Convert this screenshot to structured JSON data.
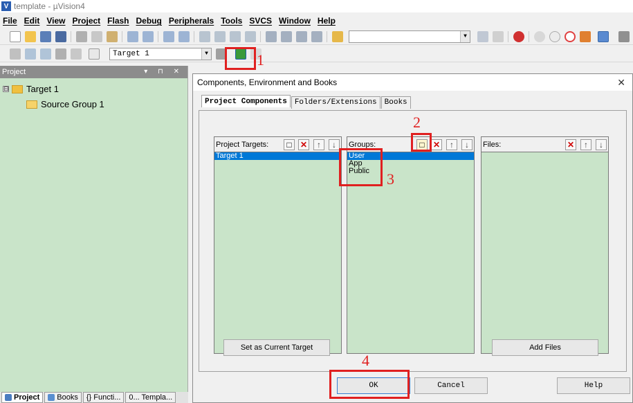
{
  "window": {
    "title": "template  - µVision4",
    "app_icon": "uv-logo-icon"
  },
  "menu": [
    "File",
    "Edit",
    "View",
    "Project",
    "Flash",
    "Debug",
    "Peripherals",
    "Tools",
    "SVCS",
    "Window",
    "Help"
  ],
  "toolbar2": {
    "target_combo": "Target 1"
  },
  "project_panel": {
    "header": "Project",
    "header_buttons": "▾ ⊓ ✕",
    "tree": [
      {
        "label": "Target 1",
        "expander": "⊟"
      },
      {
        "label": "Source Group 1"
      }
    ]
  },
  "bottom_tabs": [
    "Project",
    "Books",
    "{} Functi...",
    "0... Templa..."
  ],
  "dialog": {
    "title": "Components, Environment and Books",
    "close_glyph": "✕",
    "tabs": [
      "Project Components",
      "Folders/Extensions",
      "Books"
    ],
    "columns": {
      "targets": {
        "label": "Project Targets:",
        "items": [
          "Target 1"
        ]
      },
      "groups": {
        "label": "Groups:",
        "items": [
          "User",
          "App",
          "Public"
        ]
      },
      "files": {
        "label": "Files:",
        "items": []
      }
    },
    "buttons": {
      "set_target": "Set as Current Target",
      "add_files": "Add Files",
      "ok": "OK",
      "cancel": "Cancel",
      "help": "Help"
    }
  },
  "annotations": [
    "1",
    "2",
    "3",
    "4"
  ],
  "colors": {
    "accent_red": "#e02020",
    "panel_green": "#c9e4c9",
    "selection_blue": "#0078d7"
  }
}
